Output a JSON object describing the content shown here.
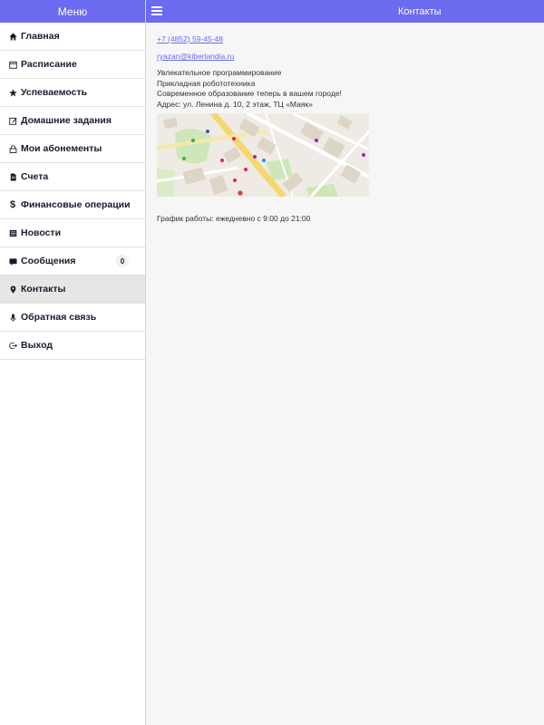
{
  "sidebar": {
    "title": "Меню",
    "items": [
      {
        "label": "Главная",
        "icon": "home-icon"
      },
      {
        "label": "Расписание",
        "icon": "calendar-icon"
      },
      {
        "label": "Успеваемость",
        "icon": "star-icon"
      },
      {
        "label": "Домашние задания",
        "icon": "edit-icon"
      },
      {
        "label": "Мои абонементы",
        "icon": "lock-icon"
      },
      {
        "label": "Счета",
        "icon": "document-icon"
      },
      {
        "label": "Финансовые операции",
        "icon": "dollar-icon"
      },
      {
        "label": "Новости",
        "icon": "news-icon"
      },
      {
        "label": "Сообщения",
        "icon": "message-icon",
        "badge": "0"
      },
      {
        "label": "Контакты",
        "icon": "location-icon",
        "active": true
      },
      {
        "label": "Обратная связь",
        "icon": "microphone-icon"
      },
      {
        "label": "Выход",
        "icon": "logout-icon"
      }
    ]
  },
  "header": {
    "title": "Контакты"
  },
  "contacts": {
    "phone": "+7 (4852) 59-45-48",
    "email": "ryazan@kiberlandia.ru",
    "lines": [
      "Увлекательное программирование",
      "Прикладная робототехника",
      "Современное образование теперь в вашем городе!",
      "Адрес: ул. Ленина д. 10, 2 этаж, ТЦ «Маяк»"
    ],
    "schedule": "График работы: ежедневно с 9:00 до 21:00"
  },
  "colors": {
    "accent": "#6b6bf0",
    "active_bg": "#e6e6e6"
  }
}
